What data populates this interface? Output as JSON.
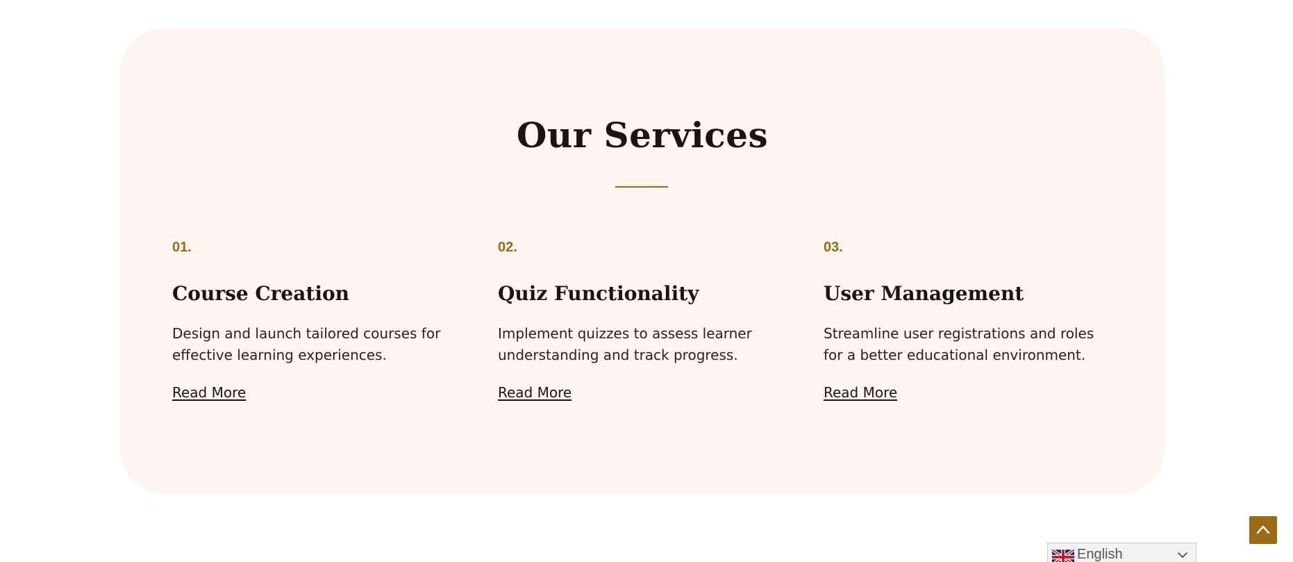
{
  "services": {
    "title": "Our Services",
    "items": [
      {
        "number": "01.",
        "title": "Course Creation",
        "description": "Design and launch tailored courses for effective learning experiences.",
        "link": "Read More"
      },
      {
        "number": "02.",
        "title": "Quiz Functionality",
        "description": "Implement quizzes to assess learner understanding and track progress.",
        "link": "Read More"
      },
      {
        "number": "03.",
        "title": "User Management",
        "description": "Streamline user registrations and roles for a better educational environment.",
        "link": "Read More"
      }
    ]
  },
  "language_switcher": {
    "selected": "English",
    "flag_icon": "uk-flag-icon",
    "chevron_icon": "chevron-down-icon"
  },
  "scroll_top": {
    "icon": "chevron-up-icon"
  },
  "colors": {
    "accent": "#9a6a17",
    "panel_background": "#fdf5f0",
    "heading_text": "#1e140d"
  }
}
